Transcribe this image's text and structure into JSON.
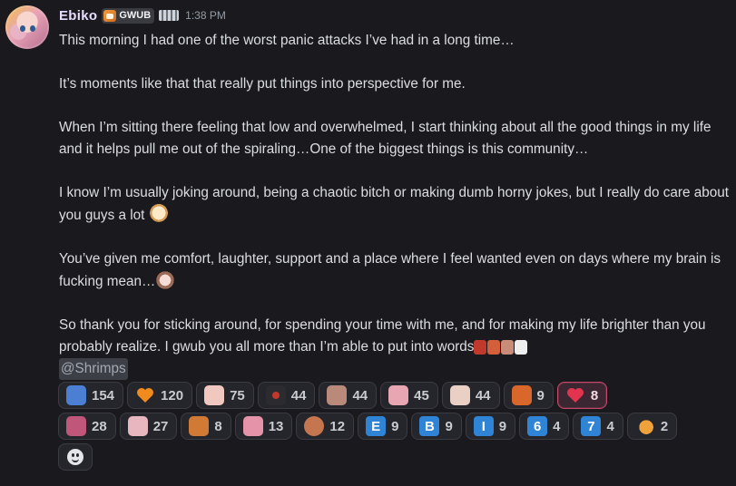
{
  "message": {
    "username": "Ebiko",
    "tag": "GWUB",
    "timestamp": "1:38 PM",
    "paragraphs": [
      "This morning I had one of the worst panic attacks I’ve had in a long time…",
      "It’s moments like that that really put things into perspective for me.",
      "When I’m sitting there feeling that low and overwhelmed, I start thinking about all the good things in my life and it helps pull me out of the spiraling…One of the biggest things is this community…",
      "I know I’m usually joking around, being a chaotic bitch or making dumb horny jokes, but I really do care about you guys a lot",
      "You’ve given me comfort, laughter, support and a place where I feel wanted even on days where my brain is fucking mean…",
      "So thank you for sticking around, for spending your time with me, and for making my life brighter than you probably realize. I gwub you all more than I’m able to put into words"
    ],
    "mention": "@Shrimps"
  },
  "reactions_row1": [
    {
      "icon": "hug-emoji-icon",
      "count": "154",
      "color": "#4a7fd4"
    },
    {
      "icon": "orange-heart-icon",
      "count": "120",
      "color": "#f08a1c"
    },
    {
      "icon": "anime-face-emote-icon",
      "count": "75",
      "color": "#f1c8c0"
    },
    {
      "icon": "sparkle-emote-icon",
      "count": "44",
      "color": "#c0392b"
    },
    {
      "icon": "chibi-emote-icon",
      "count": "44",
      "color": "#b98a7a"
    },
    {
      "icon": "pink-hair-emote-icon",
      "count": "45",
      "color": "#e8a6b3"
    },
    {
      "icon": "blush-face-emote-icon",
      "count": "44",
      "color": "#ead0c4"
    },
    {
      "icon": "tiger-emote-icon",
      "count": "9",
      "color": "#d9662b"
    },
    {
      "icon": "red-heart-icon",
      "count": "8",
      "color": "#e2334f",
      "active": true
    }
  ],
  "reactions_row2": [
    {
      "icon": "heart-hug-emote-icon",
      "count": "28",
      "color": "#c0567a"
    },
    {
      "icon": "cat-girl-emote-icon",
      "count": "27",
      "color": "#e7b6bf"
    },
    {
      "icon": "fox-emote-icon",
      "count": "8",
      "color": "#d07a35"
    },
    {
      "icon": "pink-cat-emote-icon",
      "count": "13",
      "color": "#e493a9"
    },
    {
      "icon": "cookie-face-emote-icon",
      "count": "12",
      "color": "#c5764f"
    },
    {
      "icon": "letter-e-icon",
      "letter": "E",
      "count": "9"
    },
    {
      "icon": "letter-b-icon",
      "letter": "B",
      "count": "9"
    },
    {
      "icon": "letter-i-icon",
      "letter": "I",
      "count": "9"
    },
    {
      "icon": "number-6-icon",
      "letter": "6",
      "count": "4"
    },
    {
      "icon": "number-7-icon",
      "letter": "7",
      "count": "4"
    },
    {
      "icon": "shrimp-emote-icon",
      "count": "2",
      "color": "#f0a23a"
    }
  ]
}
